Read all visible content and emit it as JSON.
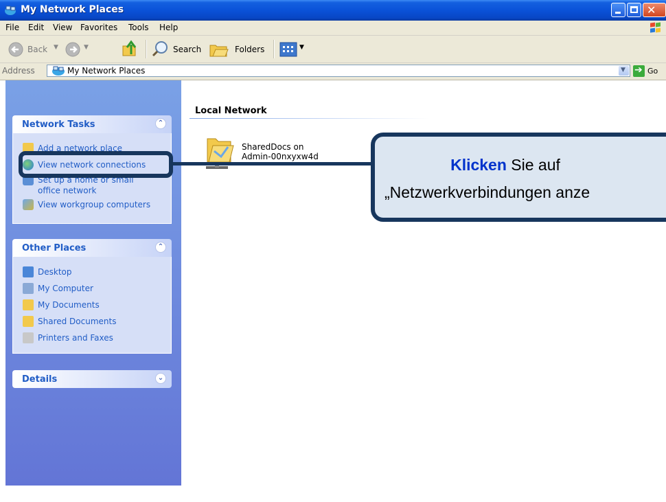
{
  "window": {
    "title": "My Network Places"
  },
  "menu": [
    "File",
    "Edit",
    "View",
    "Favorites",
    "Tools",
    "Help"
  ],
  "toolbar": {
    "back": "Back",
    "search": "Search",
    "folders": "Folders"
  },
  "address": {
    "label": "Address",
    "value": "My Network Places",
    "go": "Go"
  },
  "network_tasks": {
    "title": "Network Tasks",
    "items": [
      "Add a network place",
      "View network connections",
      "Set up a home or small",
      "office network",
      "View workgroup computers"
    ]
  },
  "other_places": {
    "title": "Other Places",
    "items": [
      "Desktop",
      "My Computer",
      "My Documents",
      "Shared Documents",
      "Printers and Faxes"
    ]
  },
  "details": {
    "title": "Details"
  },
  "content": {
    "group_title": "Local Network",
    "item_line1": "SharedDocs on",
    "item_line2": "Admin-00nxyxw4d"
  },
  "callout": {
    "bold": "Klicken",
    "rest": " Sie auf",
    "line2": "„Netzwerkverbindungen anze"
  },
  "colors": {
    "callout_border": "#17365d",
    "callout_fill": "#dce6f1",
    "link": "#215dc6",
    "title_bar": "#0a52d8"
  }
}
